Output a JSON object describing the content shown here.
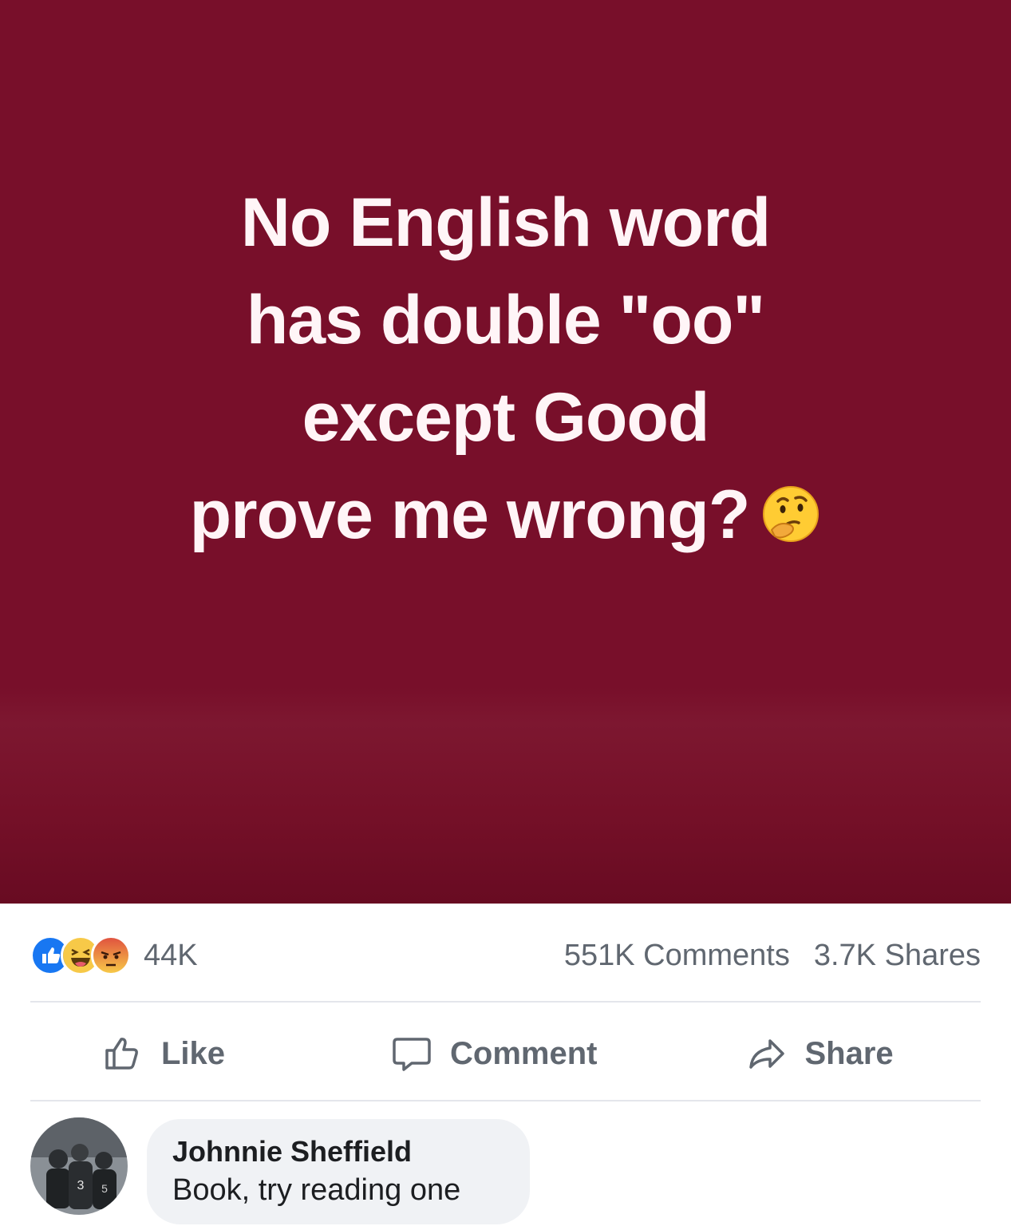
{
  "post": {
    "text_lines": [
      "No English word",
      "has double \"oo\"",
      "except Good",
      "prove me wrong?"
    ],
    "emoji": "thinking-face-emoji",
    "background_color": "#780f2a",
    "text_color": "#fff5f7"
  },
  "stats": {
    "reaction_icons": [
      "like-reaction-icon",
      "haha-reaction-icon",
      "angry-reaction-icon"
    ],
    "reaction_count": "44K",
    "comments": "551K Comments",
    "shares": "3.7K Shares"
  },
  "actions": {
    "like_label": "Like",
    "comment_label": "Comment",
    "share_label": "Share"
  },
  "comment": {
    "author": "Johnnie Sheffield",
    "text": "Book, try reading one"
  },
  "colors": {
    "like_blue": "#1877f2",
    "muted_text": "#606770",
    "bubble_bg": "#f0f2f5"
  }
}
